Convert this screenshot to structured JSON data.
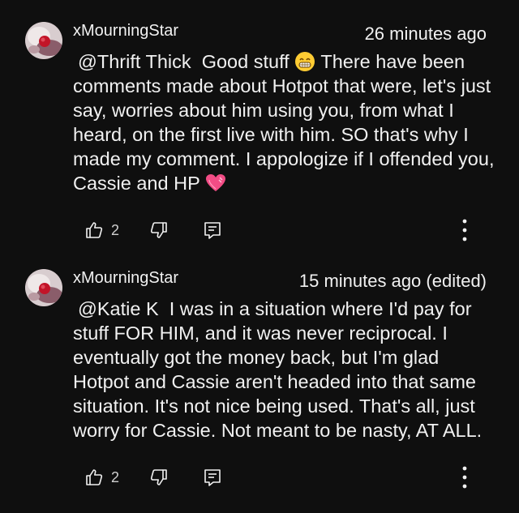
{
  "comments": [
    {
      "author": "xMourningStar",
      "time": "26 minutes ago",
      "mention": "@Thrift Thick",
      "text_before_emoji": "Good stuff",
      "emoji": "grinning-face",
      "text_after_emoji": "There have been comments made about Hotpot that were, let's just say, worries about him using you, from what I heard, on the first live with him. SO that's why I made my comment. I appologize if I offended you, Cassie and HP",
      "end_emoji": "pink-heart",
      "likes": "2"
    },
    {
      "author": "xMourningStar",
      "time": "15 minutes ago (edited)",
      "mention": "@Katie K",
      "text": "I was in a situation where I'd pay for stuff FOR HIM, and it was never reciprocal. I eventually got the money back, but I'm glad Hotpot and Cassie aren't headed into that same situation. It's not nice being used. That's all, just worry for Cassie. Not meant to be nasty, AT ALL.",
      "likes": "2"
    }
  ],
  "icons": {
    "like": "thumbs-up-icon",
    "dislike": "thumbs-down-icon",
    "reply": "reply-comment-icon",
    "more": "more-vertical-icon"
  },
  "colors": {
    "background": "#0f0f0f",
    "text": "#f1f1f1",
    "icon": "#f1f1f1"
  }
}
